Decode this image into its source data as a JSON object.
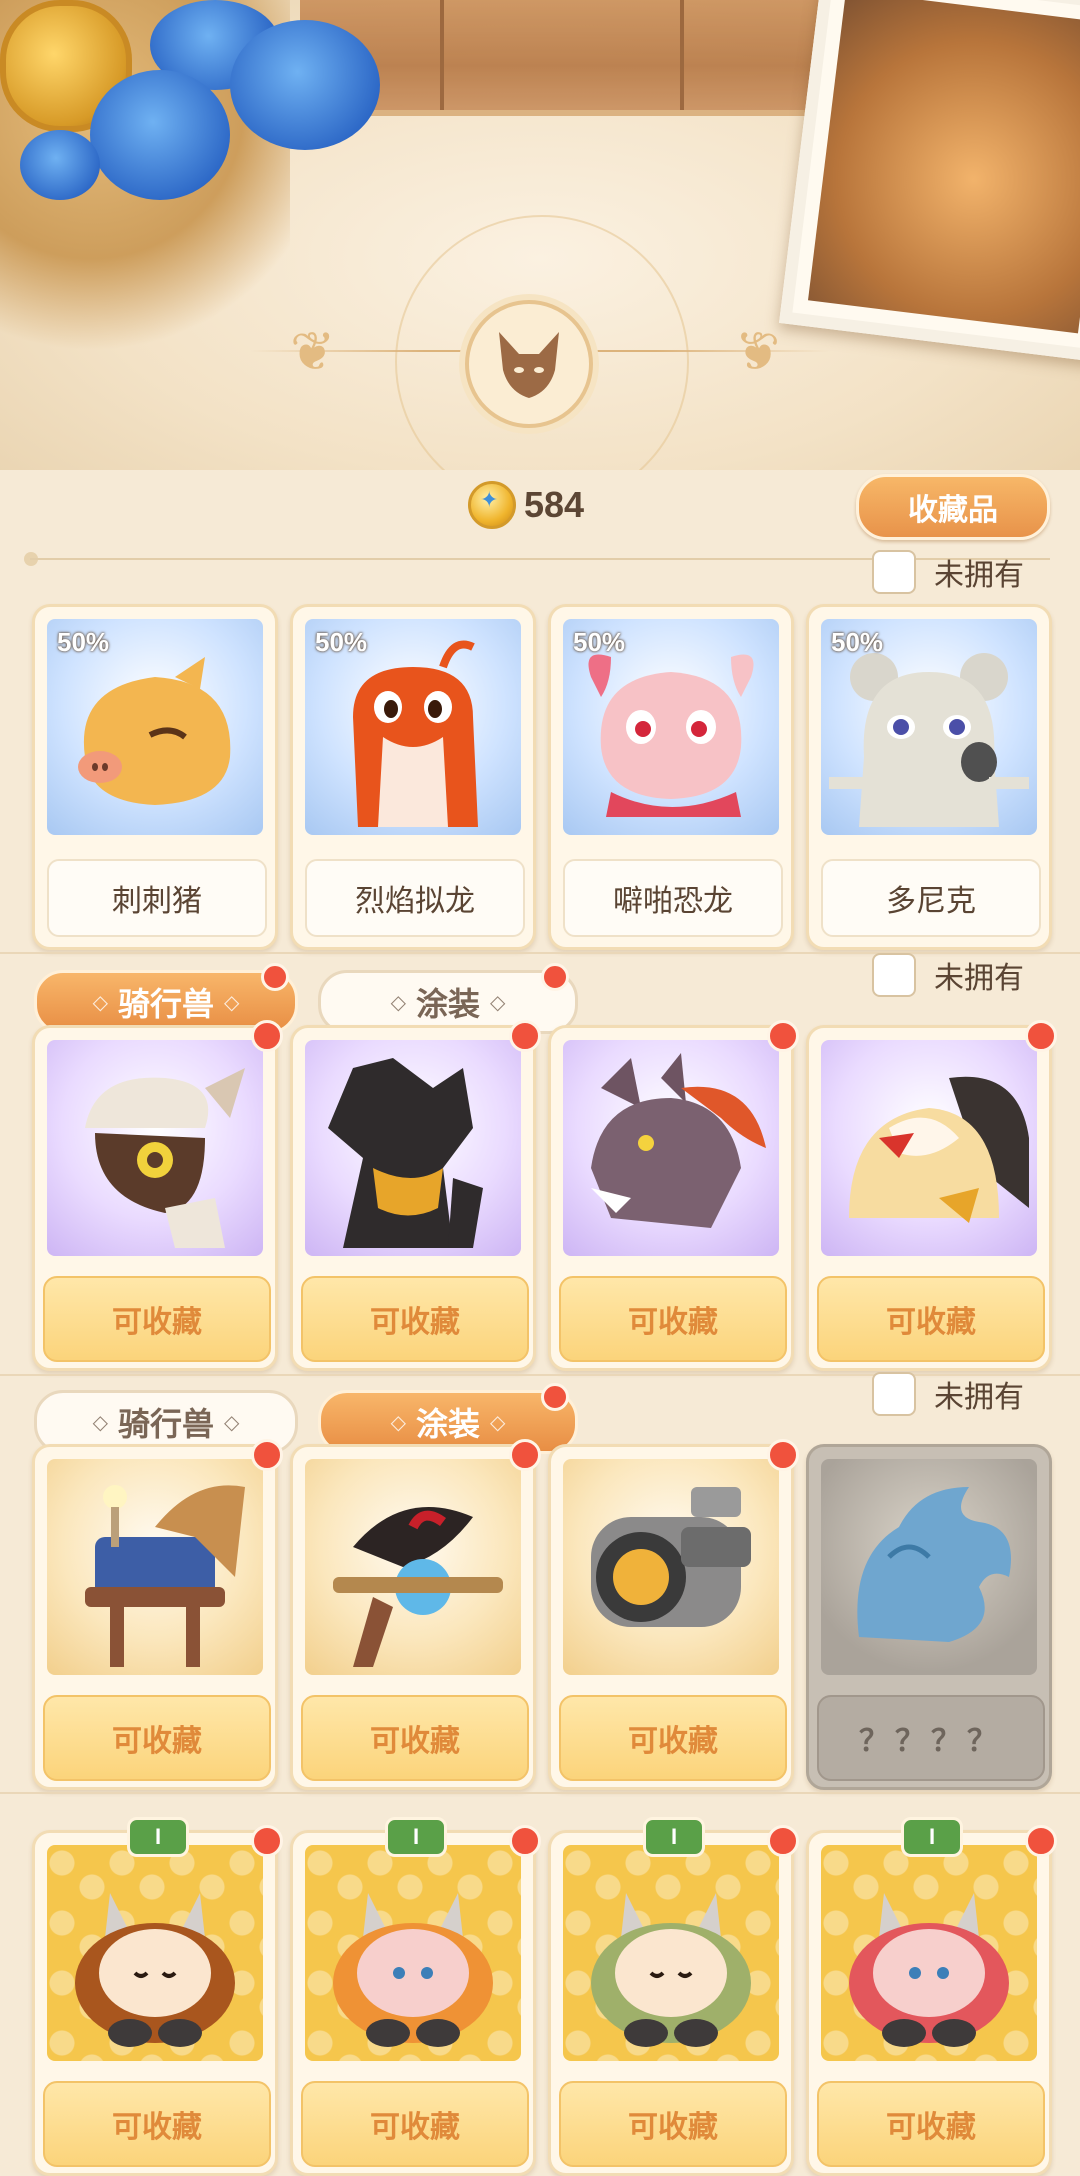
{
  "currency": {
    "amount": "584",
    "icon": "star-coin-icon"
  },
  "tab": {
    "label": "收藏品"
  },
  "filter": {
    "unowned_label": "未拥有"
  },
  "section1": {
    "cards": [
      {
        "name": "刺刺猪",
        "percent": "50%"
      },
      {
        "name": "烈焰拟龙",
        "percent": "50%"
      },
      {
        "name": "噼啪恐龙",
        "percent": "50%"
      },
      {
        "name": "多尼克",
        "percent": "50%"
      }
    ]
  },
  "section2": {
    "pills": [
      {
        "label": "骑行兽"
      },
      {
        "label": "涂装"
      }
    ],
    "active_pill": "骑行兽",
    "collect_label": "可收藏"
  },
  "section3": {
    "pills": [
      {
        "label": "骑行兽"
      },
      {
        "label": "涂装"
      }
    ],
    "active_pill": "涂装",
    "collect_label": "可收藏",
    "unknown_label": "？？？？"
  },
  "section4": {
    "tier": "I",
    "collect_label": "可收藏"
  },
  "colors": {
    "accent_orange": "#e88e44",
    "collect_text": "#e08a3a",
    "notification_red": "#f0523d",
    "tier_green": "#5aa048"
  }
}
